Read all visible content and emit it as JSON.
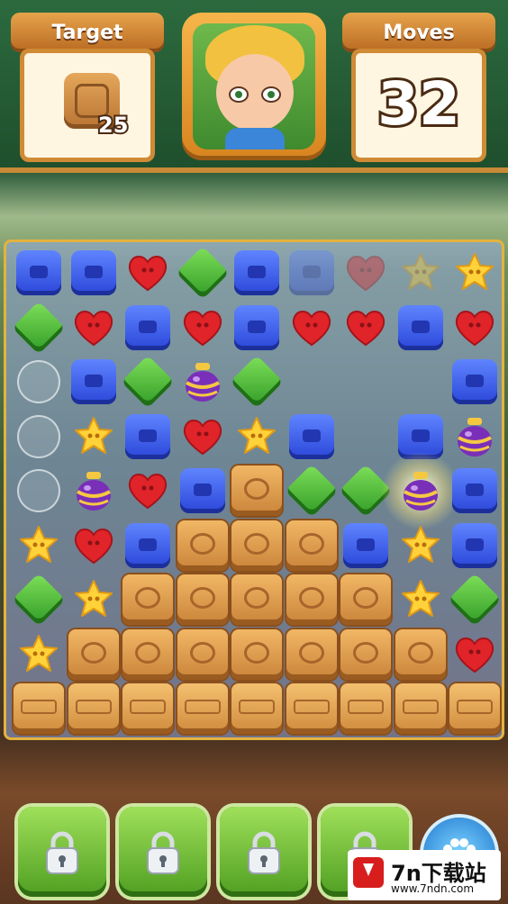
{
  "hud": {
    "target": {
      "label": "Target",
      "icon": "wood-block-icon",
      "count": "25"
    },
    "moves": {
      "label": "Moves",
      "value": "32"
    },
    "portrait": {
      "icon": "boy-character-portrait"
    }
  },
  "board": {
    "columns": 9,
    "rows": 9,
    "grid": [
      [
        "blue",
        "blue",
        "red",
        "green",
        "blue",
        "blue-faded",
        "red-faded",
        "yellow-faded",
        "yellow"
      ],
      [
        "green",
        "red",
        "blue",
        "red",
        "blue",
        "red",
        "red",
        "blue",
        "red"
      ],
      [
        "bubble",
        "blue",
        "green",
        "jar",
        "green",
        "empty",
        "empty",
        "empty",
        "blue"
      ],
      [
        "bubble",
        "yellow",
        "blue",
        "red",
        "yellow",
        "blue",
        "empty",
        "blue",
        "jar"
      ],
      [
        "bubble",
        "jar",
        "red",
        "blue",
        "wood",
        "green",
        "green",
        "jar-glow",
        "blue"
      ],
      [
        "yellow",
        "red",
        "blue",
        "wood",
        "wood",
        "wood",
        "blue",
        "yellow",
        "blue"
      ],
      [
        "green",
        "yellow",
        "wood",
        "wood",
        "wood",
        "wood",
        "wood",
        "yellow",
        "green"
      ],
      [
        "yellow",
        "wood",
        "wood",
        "wood",
        "wood",
        "wood",
        "wood",
        "wood",
        "red"
      ],
      [
        "crate",
        "crate",
        "crate",
        "crate",
        "crate",
        "crate",
        "crate",
        "crate",
        "crate"
      ]
    ],
    "piece_colors": {
      "blue": "#3a5cf0",
      "green": "#4fbf3a",
      "red": "#e0242a",
      "yellow": "#ffd23a",
      "wood": "#d9964a"
    }
  },
  "boosters": {
    "items": [
      {
        "icon": "padlock-icon",
        "locked": true
      },
      {
        "icon": "padlock-icon",
        "locked": true
      },
      {
        "icon": "padlock-icon",
        "locked": true
      },
      {
        "icon": "padlock-icon",
        "locked": true
      }
    ],
    "extra": {
      "icon": "paw-icon"
    }
  },
  "watermark": {
    "title": "7n下载站",
    "url": "www.7ndn.com"
  }
}
